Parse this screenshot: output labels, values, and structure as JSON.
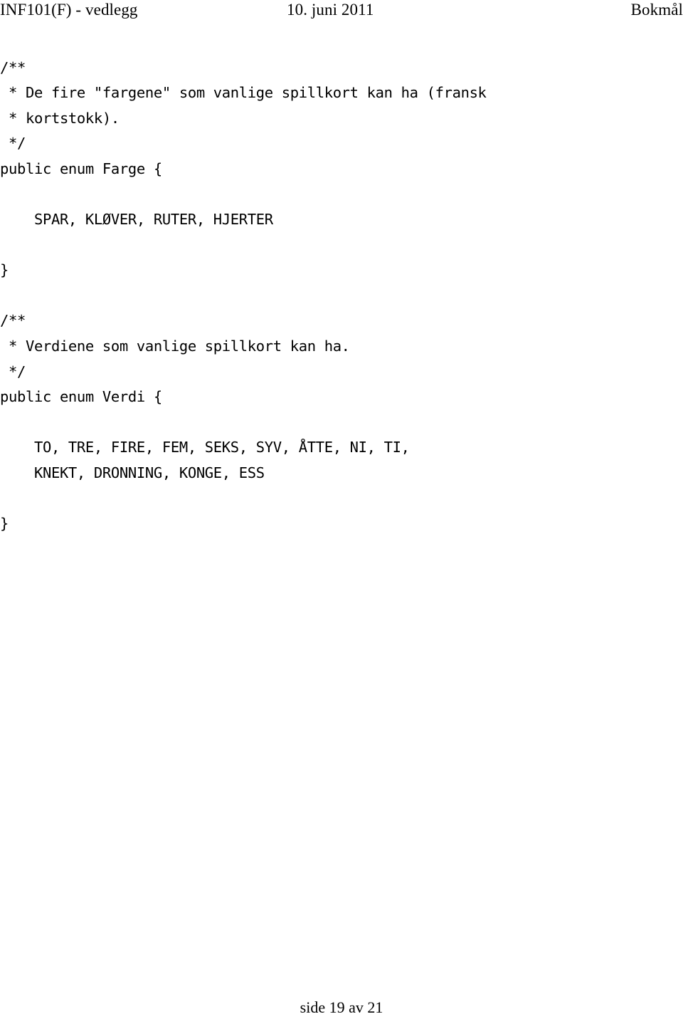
{
  "header": {
    "left": "INF101(F) - vedlegg",
    "center": "10. juni 2011",
    "right": "Bokmål"
  },
  "code": {
    "language": "java",
    "lines": [
      "/**",
      " * De fire \"fargene\" som vanlige spillkort kan ha (fransk",
      " * kortstokk).",
      " */",
      "public enum Farge {",
      "",
      "    SPAR, KLØVER, RUTER, HJERTER",
      "",
      "}",
      "",
      "/**",
      " * Verdiene som vanlige spillkort kan ha.",
      " */",
      "public enum Verdi {",
      "",
      "    TO, TRE, FIRE, FEM, SEKS, SYV, ÅTTE, NI, TI,",
      "    KNEKT, DRONNING, KONGE, ESS",
      "",
      "}"
    ]
  },
  "footer": {
    "text": "side 19 av 21"
  },
  "colors": {
    "page_background": "#ffffff",
    "text": "#000000"
  }
}
